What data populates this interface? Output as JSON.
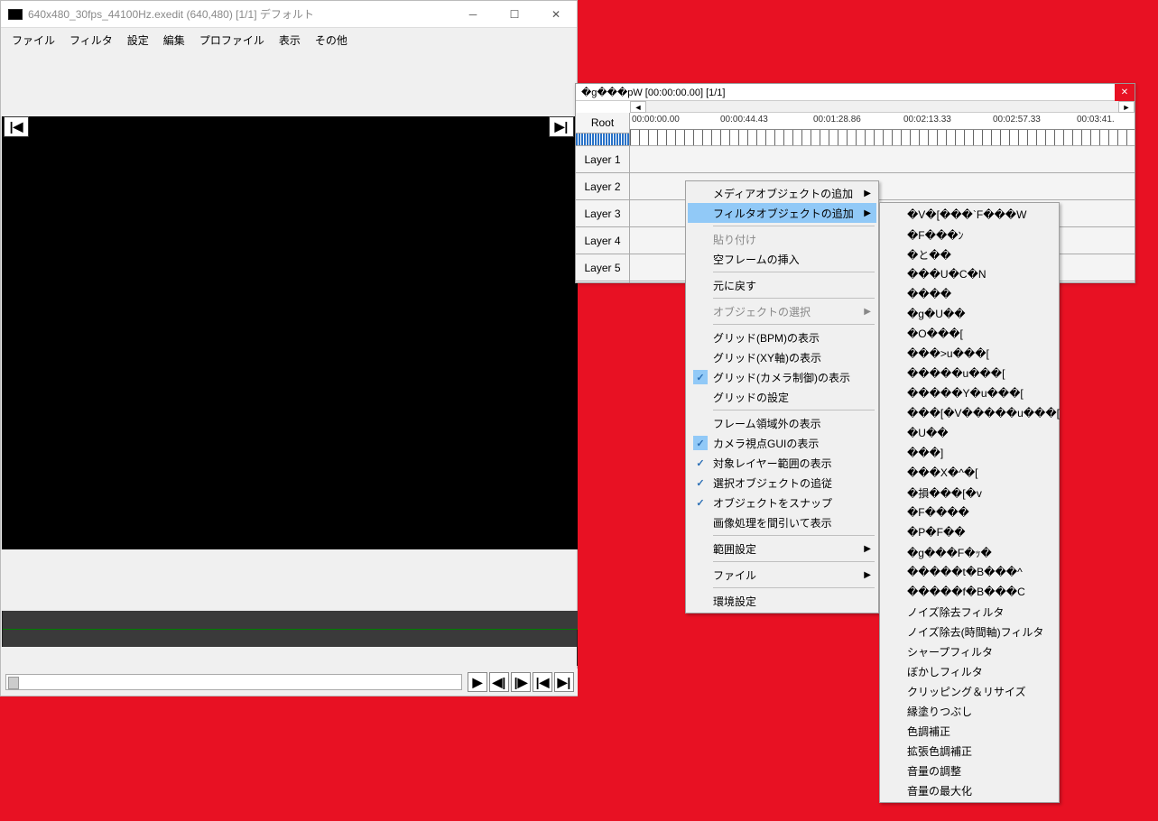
{
  "main": {
    "title": "640x480_30fps_44100Hz.exedit (640,480)  [1/1]  デフォルト",
    "menus": [
      "ファイル",
      "フィルタ",
      "設定",
      "編集",
      "プロファイル",
      "表示",
      "その他"
    ]
  },
  "timeline": {
    "title": "�g���pW [00:00:00.00] [1/1]",
    "root": "Root",
    "layers": [
      "Layer 1",
      "Layer 2",
      "Layer 3",
      "Layer 4",
      "Layer 5"
    ],
    "ruler": [
      "00:00:00.00",
      "00:00:44.43",
      "00:01:28.86",
      "00:02:13.33",
      "00:02:57.33",
      "00:03:41."
    ]
  },
  "context": {
    "items": [
      {
        "label": "メディアオブジェクトの追加",
        "sub": true
      },
      {
        "label": "フィルタオブジェクトの追加",
        "sub": true,
        "hl": true
      },
      {
        "sep": true
      },
      {
        "label": "貼り付け",
        "disabled": true
      },
      {
        "label": "空フレームの挿入"
      },
      {
        "sep": true
      },
      {
        "label": "元に戻す"
      },
      {
        "sep": true
      },
      {
        "label": "オブジェクトの選択",
        "sub": true,
        "disabled": true
      },
      {
        "sep": true
      },
      {
        "label": "グリッド(BPM)の表示"
      },
      {
        "label": "グリッド(XY軸)の表示"
      },
      {
        "label": "グリッド(カメラ制御)の表示",
        "check": "blue"
      },
      {
        "label": "グリッドの設定"
      },
      {
        "sep": true
      },
      {
        "label": "フレーム領域外の表示"
      },
      {
        "label": "カメラ視点GUIの表示",
        "check": "blue"
      },
      {
        "label": "対象レイヤー範囲の表示",
        "check": "plain"
      },
      {
        "label": "選択オブジェクトの追従",
        "check": "plain"
      },
      {
        "label": "オブジェクトをスナップ",
        "check": "plain"
      },
      {
        "label": "画像処理を間引いて表示"
      },
      {
        "sep": true
      },
      {
        "label": "範囲設定",
        "sub": true
      },
      {
        "sep": true
      },
      {
        "label": "ファイル",
        "sub": true
      },
      {
        "sep": true
      },
      {
        "label": "環境設定"
      }
    ]
  },
  "submenu": [
    "�V�[���`F���W",
    "�F���ﾝ",
    "�と��",
    "���U�C�N",
    "����",
    "�g�U��",
    "�O���[",
    "���>u���[",
    "�����u���[",
    "�����Y�u���[",
    "���[�V�����u���[",
    "�U��",
    "���]",
    "���X�^�[",
    "�損���[�v",
    "�F����",
    "�P�F��",
    "�g���F�ｯ�",
    "�����t�B���^",
    "�����f�B���C",
    "ノイズ除去フィルタ",
    "ノイズ除去(時間軸)フィルタ",
    "シャープフィルタ",
    "ぼかしフィルタ",
    "クリッピング＆リサイズ",
    "縁塗りつぶし",
    "色調補正",
    "拡張色調補正",
    "音量の調整",
    "音量の最大化"
  ]
}
